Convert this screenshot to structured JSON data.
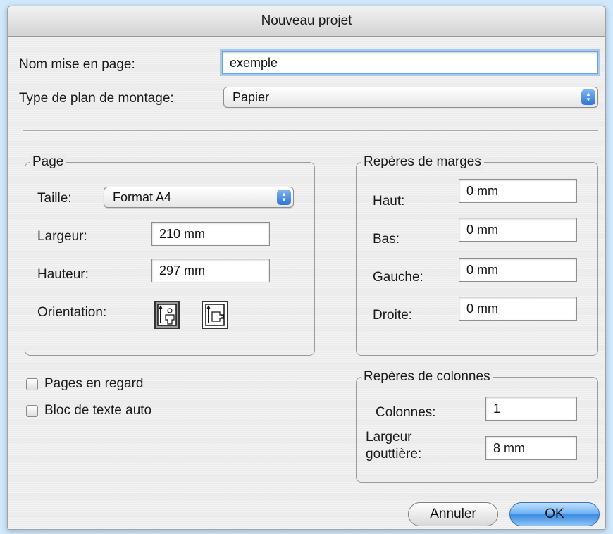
{
  "dialog": {
    "title": "Nouveau projet",
    "layout_name": {
      "label": "Nom mise en page:",
      "value": "exemple"
    },
    "plan_type": {
      "label": "Type de plan de montage:",
      "value": "Papier"
    }
  },
  "page_group": {
    "title": "Page",
    "size": {
      "label": "Taille:",
      "value": "Format A4"
    },
    "width": {
      "label": "Largeur:",
      "value": "210 mm"
    },
    "height": {
      "label": "Hauteur:",
      "value": "297 mm"
    },
    "orientation": {
      "label": "Orientation:",
      "selected": "portrait",
      "options": [
        "portrait-icon",
        "landscape-icon"
      ]
    }
  },
  "margins_group": {
    "title": "Repères de marges",
    "top": {
      "label": "Haut:",
      "value": "0 mm"
    },
    "bottom": {
      "label": "Bas:",
      "value": "0 mm"
    },
    "left": {
      "label": "Gauche:",
      "value": "0 mm"
    },
    "right": {
      "label": "Droite:",
      "value": "0 mm"
    }
  },
  "options": {
    "facing_pages": {
      "label": "Pages en regard",
      "checked": false
    },
    "auto_text_box": {
      "label": "Bloc de texte auto",
      "checked": false
    }
  },
  "columns_group": {
    "title": "Repères de colonnes",
    "columns": {
      "label": "Colonnes:",
      "value": "1"
    },
    "gutter": {
      "label_line1": "Largeur",
      "label_line2": "gouttière:",
      "value": "8 mm"
    }
  },
  "buttons": {
    "cancel": "Annuler",
    "ok": "OK"
  },
  "colors": {
    "accent": "#3b8be3",
    "background": "#cfe8fb"
  }
}
